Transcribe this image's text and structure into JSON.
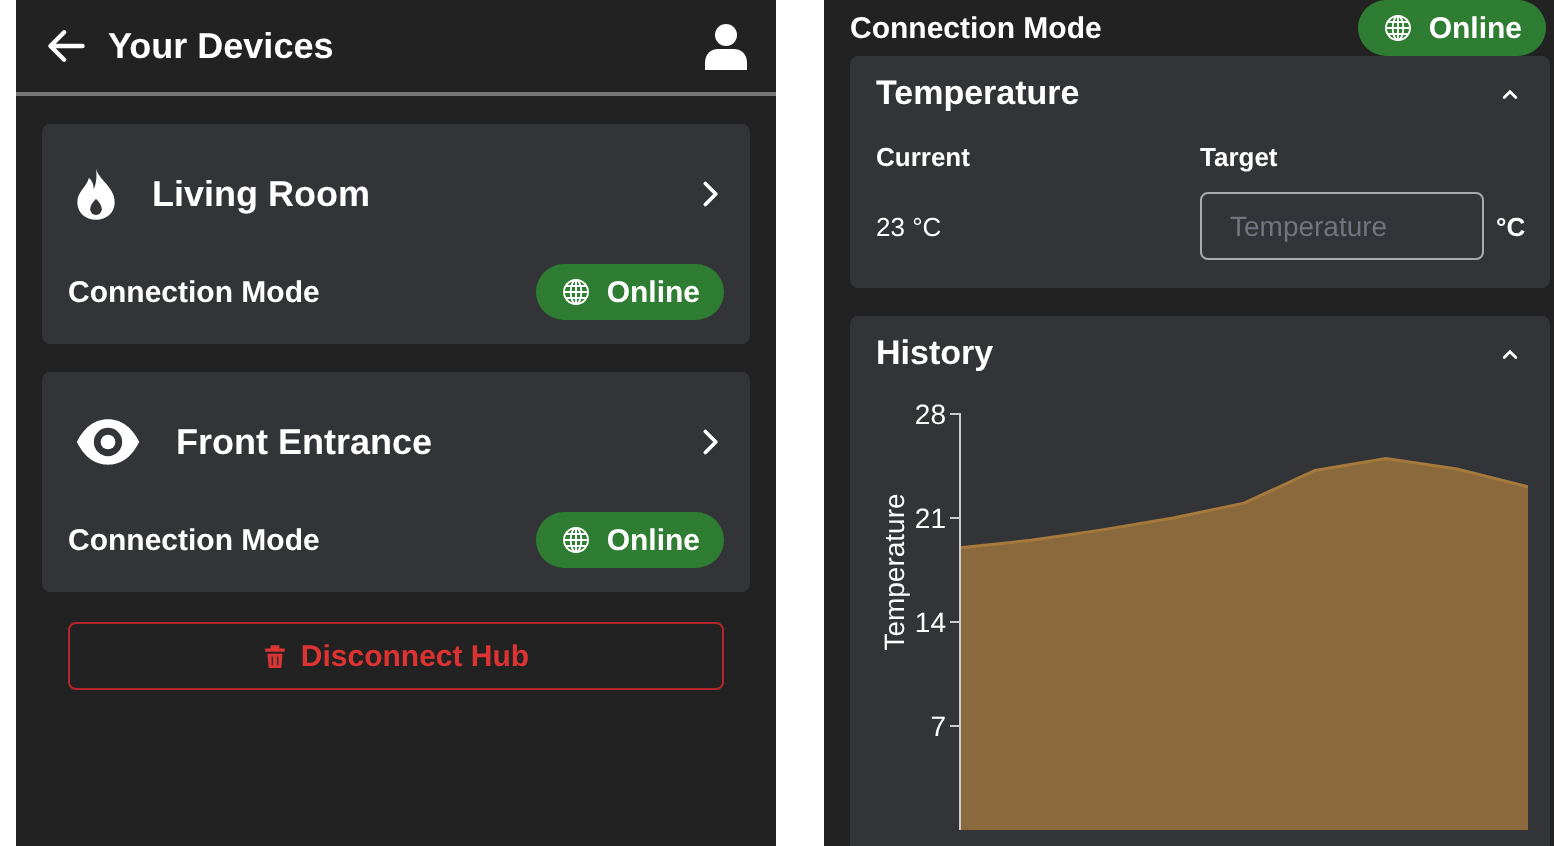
{
  "devices_screen": {
    "header": {
      "title": "Your Devices"
    },
    "devices": [
      {
        "name": "Living Room",
        "kind": "flame",
        "connection_label": "Connection Mode",
        "status": "Online"
      },
      {
        "name": "Front Entrance",
        "kind": "eye",
        "connection_label": "Connection Mode",
        "status": "Online"
      }
    ],
    "disconnect_button": "Disconnect Hub"
  },
  "device_screen": {
    "connection": {
      "label": "Connection Mode",
      "status": "Online"
    },
    "temperature_panel": {
      "title": "Temperature",
      "expanded": true,
      "current_label": "Current",
      "target_label": "Target",
      "current_value": "23 °C",
      "target_placeholder": "Temperature",
      "unit": "°C"
    },
    "history_panel": {
      "title": "History",
      "expanded": true,
      "chart_data": {
        "type": "area",
        "ylabel": "Temperature",
        "ylim": [
          0,
          28
        ],
        "yticks": [
          {
            "value": 7,
            "label": "7"
          },
          {
            "value": 14,
            "label": "14"
          },
          {
            "value": 21,
            "label": "21"
          },
          {
            "value": 28,
            "label": "28"
          }
        ],
        "categories": [
          null,
          null,
          null,
          null,
          null,
          null,
          null,
          null,
          null
        ],
        "series": [
          {
            "color": "#a57a3c",
            "values": [
              19.0,
              19.5,
              20.2,
              21.0,
              22.0,
              24.2,
              25.0,
              24.3,
              23.1
            ]
          }
        ]
      }
    }
  }
}
